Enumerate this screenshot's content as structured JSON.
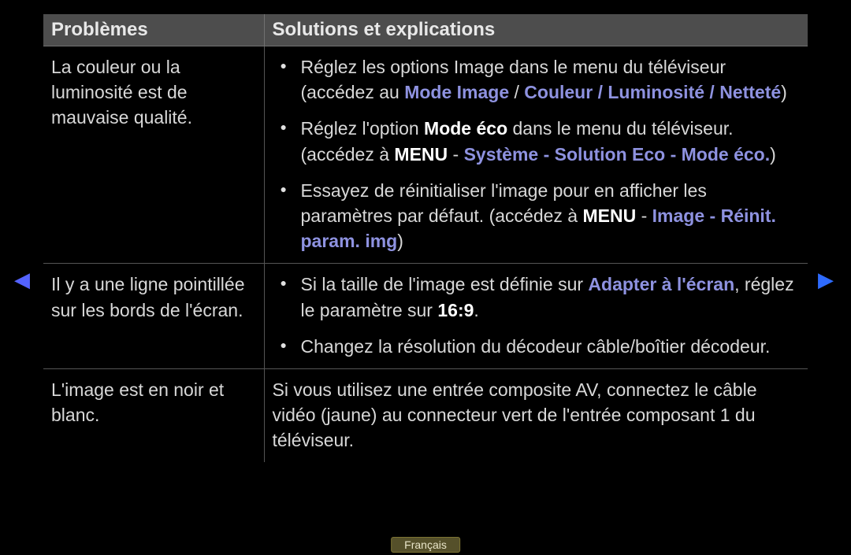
{
  "headers": {
    "problems": "Problèmes",
    "solutions": "Solutions et explications"
  },
  "rows": [
    {
      "problem": "La couleur ou la luminosité est de mauvaise qualité.",
      "bullets": true,
      "items": [
        {
          "segments": [
            {
              "t": "Réglez les options Image dans le menu du téléviseur (accédez au "
            },
            {
              "t": "Mode Image",
              "c": "link"
            },
            {
              "t": " / "
            },
            {
              "t": "Couleur / Luminosité / Netteté",
              "c": "link"
            },
            {
              "t": ")"
            }
          ]
        },
        {
          "segments": [
            {
              "t": "Réglez l'option "
            },
            {
              "t": "Mode éco",
              "c": "bold"
            },
            {
              "t": " dans le menu du téléviseur. (accédez à "
            },
            {
              "t": "MENU",
              "c": "bold"
            },
            {
              "t": " - "
            },
            {
              "t": "Système - Solution Eco - Mode éco.",
              "c": "link"
            },
            {
              "t": ")"
            }
          ]
        },
        {
          "segments": [
            {
              "t": "Essayez de réinitialiser l'image pour en afficher les paramètres par défaut. (accédez à "
            },
            {
              "t": "MENU",
              "c": "bold"
            },
            {
              "t": " - "
            },
            {
              "t": "Image - Réinit. param. img",
              "c": "link"
            },
            {
              "t": ")"
            }
          ]
        }
      ]
    },
    {
      "problem": "Il y a une ligne pointillée sur les bords de l'écran.",
      "bullets": true,
      "items": [
        {
          "segments": [
            {
              "t": "Si la taille de l'image est définie sur "
            },
            {
              "t": "Adapter à l'écran",
              "c": "link"
            },
            {
              "t": ", réglez le paramètre sur "
            },
            {
              "t": "16:9",
              "c": "bold"
            },
            {
              "t": "."
            }
          ]
        },
        {
          "segments": [
            {
              "t": "Changez la résolution du décodeur câble/boîtier décodeur."
            }
          ]
        }
      ]
    },
    {
      "problem": "L'image est en noir et blanc.",
      "bullets": false,
      "items": [
        {
          "segments": [
            {
              "t": "Si vous utilisez une entrée composite AV, connectez le câble vidéo (jaune) au connecteur vert de l'entrée composant 1 du téléviseur."
            }
          ]
        }
      ]
    }
  ],
  "nav": {
    "left": "◀",
    "right": "▶"
  },
  "language": "Français"
}
